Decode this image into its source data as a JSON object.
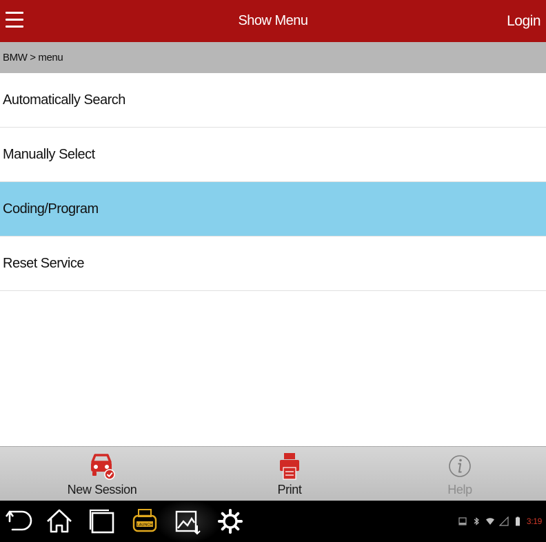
{
  "topbar": {
    "title": "Show Menu",
    "login_label": "Login",
    "color": "#a81111"
  },
  "breadcrumb": {
    "text": "BMW > menu"
  },
  "menu": {
    "items": [
      {
        "label": "Automatically Search",
        "selected": false
      },
      {
        "label": "Manually Select",
        "selected": false
      },
      {
        "label": "Coding/Program",
        "selected": true
      },
      {
        "label": "Reset Service",
        "selected": false
      }
    ],
    "selected_color": "#87d0ec"
  },
  "toolbar": {
    "new_session": {
      "label": "New Session",
      "icon": "car-check-icon"
    },
    "print": {
      "label": "Print",
      "icon": "printer-icon"
    },
    "help": {
      "label": "Help",
      "icon": "info-icon",
      "enabled": false
    }
  },
  "navbar": {
    "icons": [
      "back-icon",
      "home-icon",
      "recent-apps-icon",
      "launch-app-icon",
      "screenshot-icon",
      "settings-icon"
    ]
  },
  "status": {
    "time": "3:19",
    "icons": [
      "sd-card-icon",
      "bluetooth-icon",
      "wifi-icon",
      "signal-icon",
      "battery-icon"
    ]
  }
}
